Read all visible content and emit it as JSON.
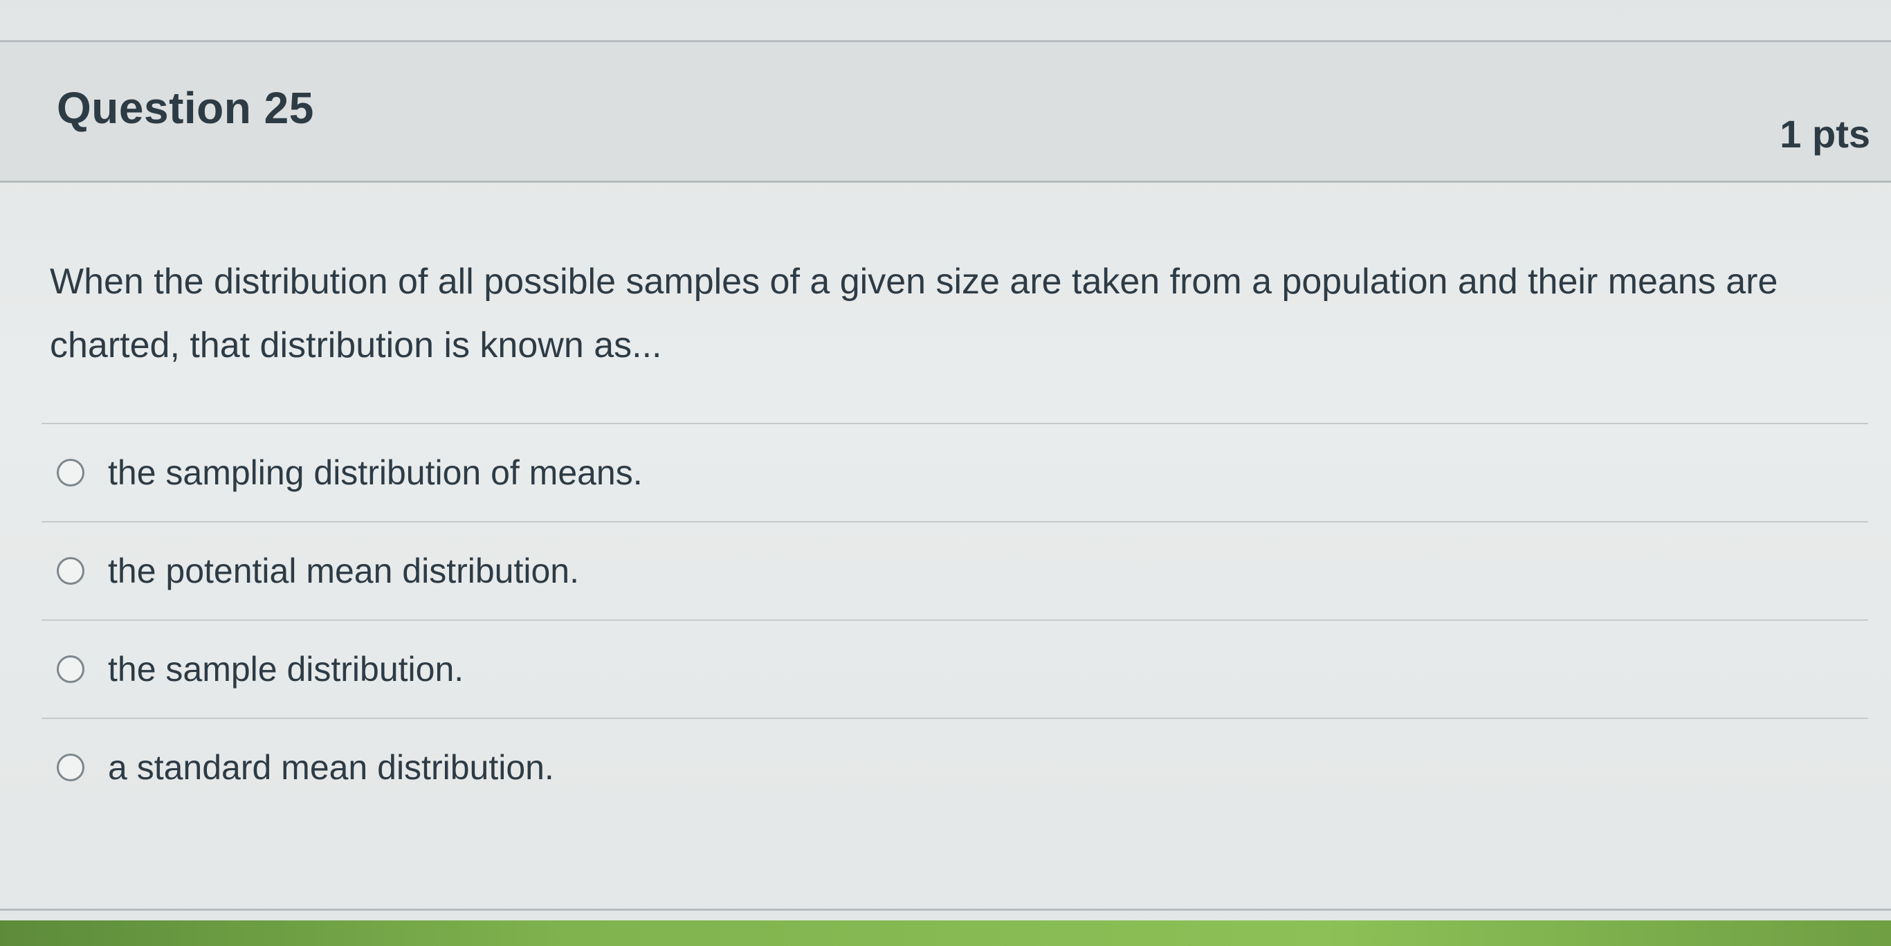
{
  "question": {
    "title": "Question 25",
    "points": "1 pts",
    "text": "When the distribution of all possible samples of a given size are taken from a population and their means are charted, that distribution is known as..."
  },
  "answers": [
    {
      "label": "the sampling distribution of means.",
      "selected": false
    },
    {
      "label": "the potential mean distribution.",
      "selected": false
    },
    {
      "label": "the sample distribution.",
      "selected": false
    },
    {
      "label": "a standard mean distribution.",
      "selected": false
    }
  ],
  "colors": {
    "text": "#2d3b45",
    "header_bg": "#dcdfdf",
    "divider": "#c4c9cc",
    "accent_bar": "#8dc157"
  }
}
